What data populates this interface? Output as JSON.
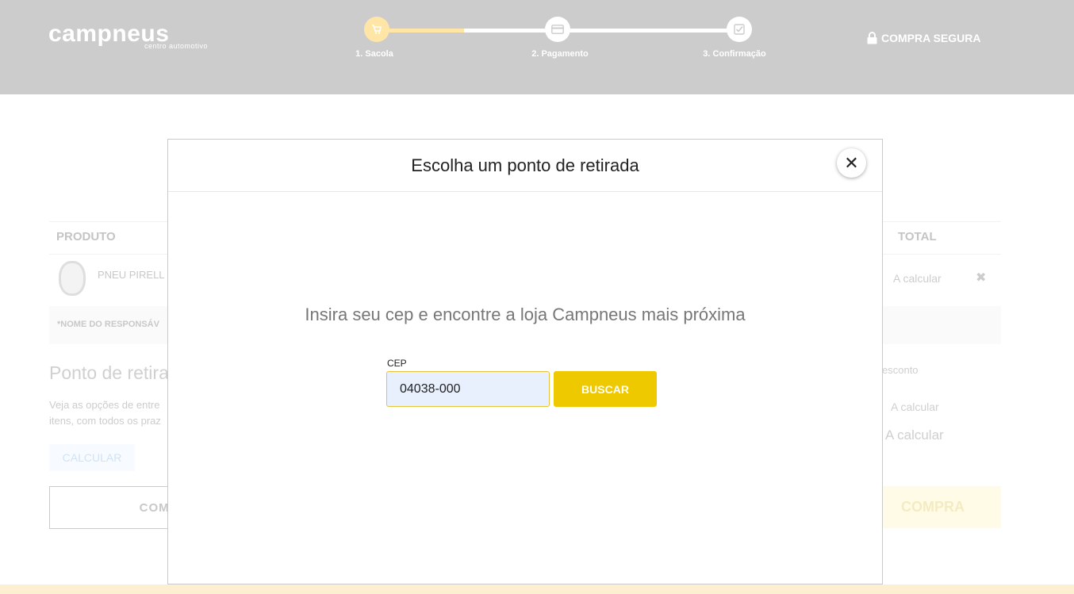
{
  "header": {
    "logo": {
      "main": "campneus",
      "sub": "centro automotivo"
    },
    "steps": [
      {
        "label": "1. Sacola",
        "icon": "cart-icon",
        "active": true
      },
      {
        "label": "2. Pagamento",
        "icon": "card-icon",
        "active": false
      },
      {
        "label": "3. Confirmação",
        "icon": "check-icon",
        "active": false
      }
    ],
    "progress_fraction": 0.24,
    "secure": {
      "label": "COMPRA SEGURA",
      "icon": "lock-icon"
    }
  },
  "cart": {
    "columns": {
      "product": "PRODUTO",
      "total": "TOTAL"
    },
    "item": {
      "name": "PNEU PIRELL",
      "total": "A calcular",
      "remove_icon": "remove-icon"
    },
    "responsible_label": "*NOME DO RESPONSÁV",
    "pickup": {
      "title": "Ponto de retira",
      "description": "Veja as opções de entre itens, com todos os praz",
      "calculate_label": "CALCULAR"
    },
    "continue_label": "COMPRA",
    "summary": {
      "discount_label": "esconto",
      "shipping_value": "A calcular",
      "total_value": "A calcular"
    },
    "finish_label": "COMPRA"
  },
  "modal": {
    "title": "Escolha um ponto de retirada",
    "close_icon": "close-icon",
    "lead": "Insira seu cep e encontre a loja Campneus mais próxima",
    "cep": {
      "label": "CEP",
      "value": "04038-000"
    },
    "search_label": "BUSCAR"
  },
  "colors": {
    "header_bg": "#cccccc",
    "accent_yellow": "#efc900",
    "progress_fill": "#ffe6a6"
  }
}
